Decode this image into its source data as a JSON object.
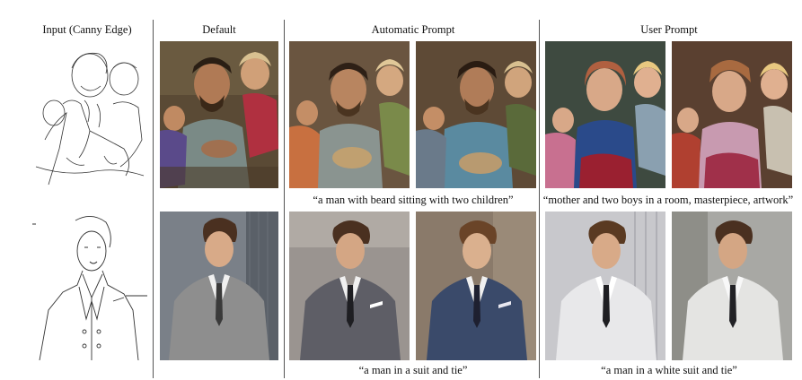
{
  "figure": {
    "headers": {
      "input": "Input (Canny Edge)",
      "default": "Default",
      "automatic": "Automatic Prompt",
      "user": "User Prompt"
    },
    "rows": [
      {
        "automatic_caption": "“a man with beard sitting with two children”",
        "user_caption": "“mother and two boys in a room, masterpiece, artwork”"
      },
      {
        "automatic_caption": "“a man in a suit and tie”",
        "user_caption": "“a man in a white suit and tie”"
      }
    ],
    "colors": {
      "divider": "#555555",
      "family_bg": "#5a4a35",
      "suit_gray": "#8e8e8e",
      "suit_blue": "#3a4a6a",
      "suit_white": "#e8e8ea"
    }
  }
}
